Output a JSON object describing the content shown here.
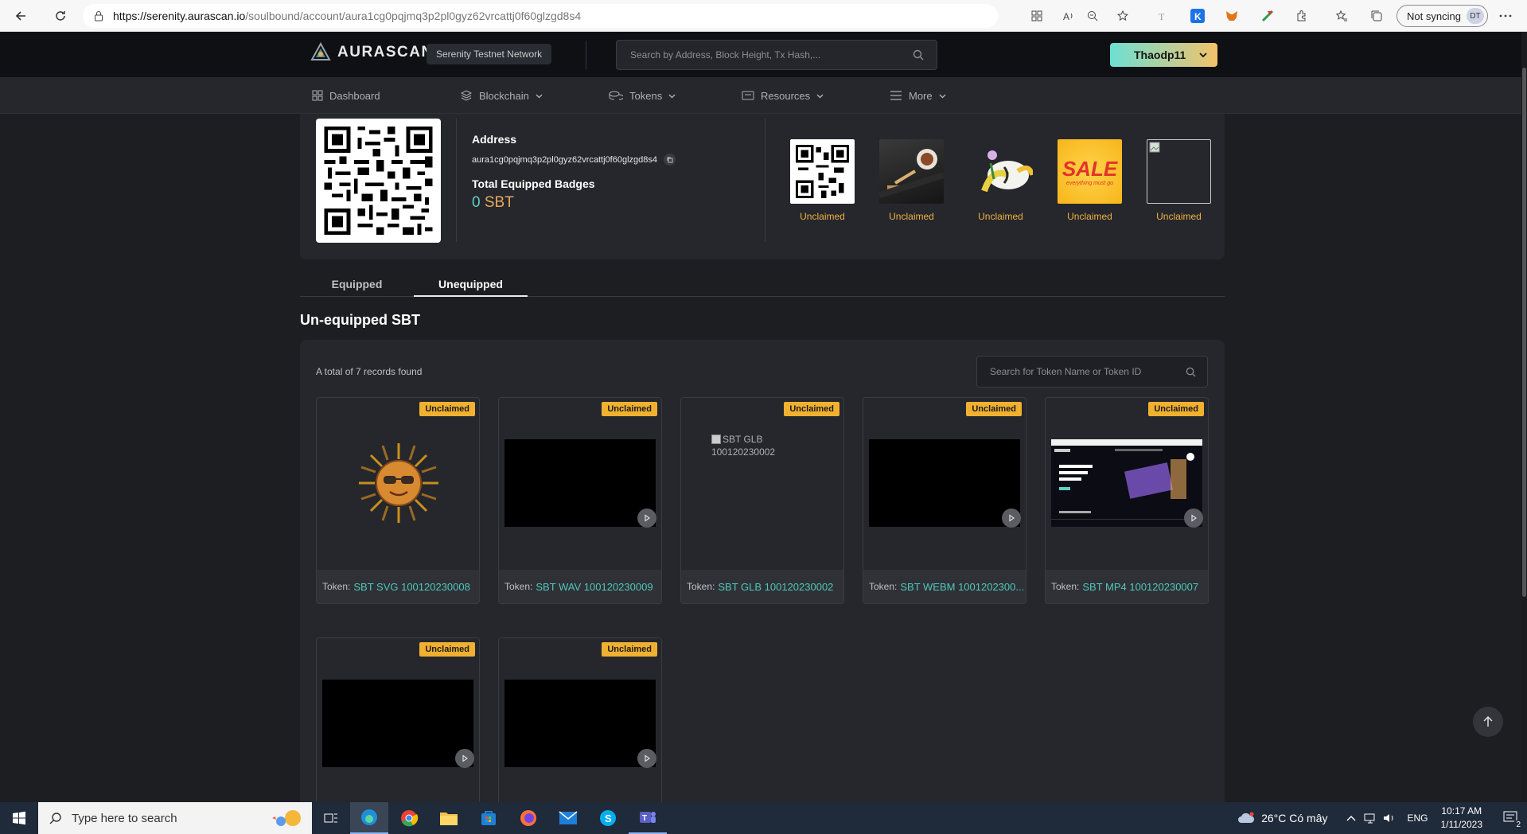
{
  "browser": {
    "url_host": "https://serenity.aurascan.io",
    "url_path": "/soulbound/account/aura1cg0pqjmq3p2pl0gyz62vrcattj0f60glzgd8s4",
    "sync_label": "Not syncing",
    "avatar_initials": "DT"
  },
  "header": {
    "logo_text": "AURASCAN",
    "network": "Serenity Testnet Network",
    "search_placeholder": "Search by Address, Block Height, Tx Hash,...",
    "user": "Thaodp11"
  },
  "nav": {
    "items": [
      {
        "label": "Dashboard",
        "icon": "grid-icon"
      },
      {
        "label": "Blockchain",
        "icon": "layers-icon"
      },
      {
        "label": "Tokens",
        "icon": "coins-icon"
      },
      {
        "label": "Resources",
        "icon": "wallet-icon"
      },
      {
        "label": "More",
        "icon": "menu-icon"
      }
    ]
  },
  "profile": {
    "address_label": "Address",
    "address": "aura1cg0pqjmq3p2pl0gyz62vrcattj0f60glzgd8s4",
    "badges_label": "Total Equipped Badges",
    "badges_count": "0",
    "badges_unit": "SBT",
    "thumbs": [
      {
        "label": "Unclaimed",
        "kind": "qr"
      },
      {
        "label": "Unclaimed",
        "kind": "photo"
      },
      {
        "label": "Unclaimed",
        "kind": "illustration"
      },
      {
        "label": "Unclaimed",
        "kind": "sale"
      },
      {
        "label": "Unclaimed",
        "kind": "broken"
      }
    ],
    "sale_text": "SALE",
    "sale_sub": "everything must go"
  },
  "tabs": {
    "equipped": "Equipped",
    "unequipped": "Unequipped"
  },
  "section_title": "Un-equipped SBT",
  "records_text": "A total of 7 records found",
  "token_search_placeholder": "Search for Token Name or Token ID",
  "cards": [
    {
      "badge": "Unclaimed",
      "prefix": "Token:",
      "name": "SBT SVG 100120230008",
      "media": "sun"
    },
    {
      "badge": "Unclaimed",
      "prefix": "Token:",
      "name": "SBT WAV 100120230009",
      "media": "video"
    },
    {
      "badge": "Unclaimed",
      "prefix": "Token:",
      "name": "SBT GLB 100120230002",
      "media": "broken",
      "alt": "SBT GLB 100120230002"
    },
    {
      "badge": "Unclaimed",
      "prefix": "Token:",
      "name": "SBT WEBM 1001202300...",
      "media": "video"
    },
    {
      "badge": "Unclaimed",
      "prefix": "Token:",
      "name": "SBT MP4 100120230007",
      "media": "screenshot"
    },
    {
      "badge": "Unclaimed",
      "media": "video"
    },
    {
      "badge": "Unclaimed",
      "media": "video"
    }
  ],
  "taskbar": {
    "search_placeholder": "Type here to search",
    "weather": "26°C  Có mây",
    "lang": "ENG",
    "time": "10:17 AM",
    "date": "1/11/2023",
    "notif_count": "2"
  }
}
